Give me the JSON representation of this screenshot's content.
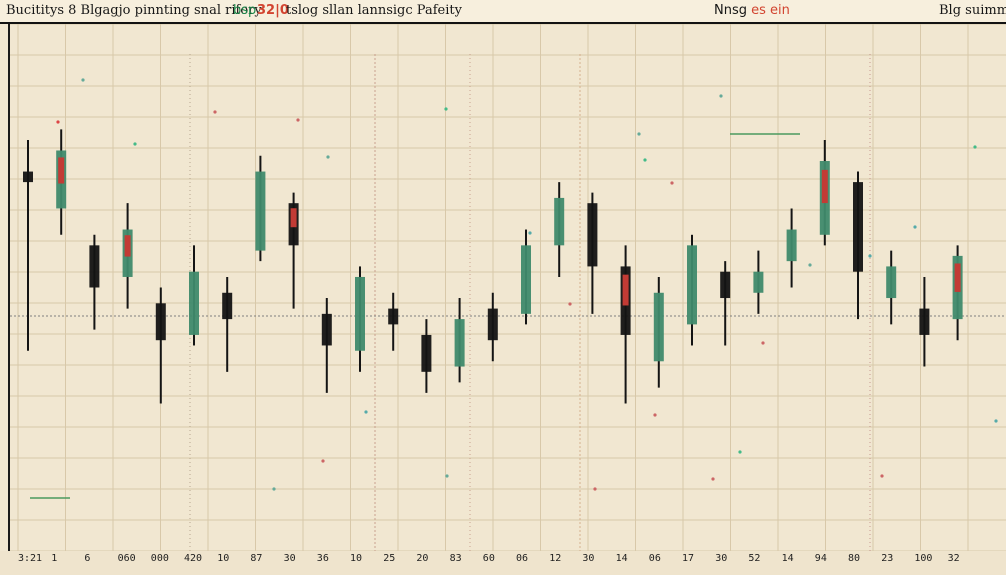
{
  "header": {
    "left_title": "Bucititys 8 Blgagjo pinnting snal rifory",
    "ticker": "bsp",
    "badge": "32|0",
    "right_title": "tslog sllan lannsigc Pafeity",
    "right_label_prefix": "Nnsg ",
    "right_label_accent": "es ein",
    "corner_label": "Blg suimmnt"
  },
  "chart_data": {
    "type": "candlestick",
    "title": "",
    "xlabel": "",
    "ylabel": "",
    "grid": true,
    "legend": "none",
    "ylim": [
      0,
      100
    ],
    "x": [
      "3:21",
      "1",
      "6",
      "060",
      "000",
      "420",
      "10",
      "87",
      "30",
      "36",
      "10",
      "25",
      "20",
      "83",
      "60",
      "06",
      "12",
      "30",
      "14",
      "06",
      "17",
      "30",
      "52",
      "14",
      "94",
      "80",
      "23",
      "100",
      "32"
    ],
    "series": [
      {
        "name": "",
        "values": [
          [
            72,
            70,
            78,
            38
          ],
          [
            65,
            76,
            80,
            60
          ],
          [
            58,
            50,
            60,
            42
          ],
          [
            52,
            61,
            66,
            46
          ],
          [
            47,
            40,
            50,
            28
          ],
          [
            41,
            53,
            58,
            39
          ],
          [
            49,
            44,
            52,
            34
          ],
          [
            57,
            72,
            75,
            55
          ],
          [
            66,
            58,
            68,
            46
          ],
          [
            45,
            39,
            48,
            30
          ],
          [
            38,
            52,
            54,
            34
          ],
          [
            46,
            43,
            49,
            38
          ],
          [
            41,
            34,
            44,
            30
          ],
          [
            35,
            44,
            48,
            32
          ],
          [
            46,
            40,
            49,
            36
          ],
          [
            45,
            58,
            61,
            43
          ],
          [
            58,
            67,
            70,
            52
          ],
          [
            66,
            54,
            68,
            45
          ],
          [
            54,
            41,
            58,
            28
          ],
          [
            36,
            49,
            52,
            31
          ],
          [
            43,
            58,
            60,
            39
          ],
          [
            53,
            48,
            55,
            39
          ],
          [
            49,
            53,
            57,
            45
          ],
          [
            55,
            61,
            65,
            50
          ],
          [
            60,
            74,
            78,
            58
          ],
          [
            70,
            53,
            72,
            44
          ],
          [
            48,
            54,
            57,
            43
          ],
          [
            46,
            41,
            52,
            35
          ],
          [
            44,
            56,
            58,
            40
          ]
        ]
      }
    ]
  },
  "bottom": {
    "axis_labels": [
      "3:21",
      "1",
      "6",
      "060",
      "000",
      "420",
      "10",
      "87",
      "30",
      "36",
      "10",
      "25",
      "20",
      "83",
      "60",
      "06",
      "12",
      "30",
      "14",
      "06",
      "17",
      "30",
      "52",
      "14",
      "94",
      "80",
      "23",
      "100",
      "32"
    ]
  },
  "colors": {
    "background": "#f1e7d1",
    "grid": "#d8c8a9",
    "dark": "#131313",
    "green": "#3f8a6b",
    "red": "#c23b35",
    "accent_red": "#d24430",
    "accent_green": "#1f8b4d"
  }
}
